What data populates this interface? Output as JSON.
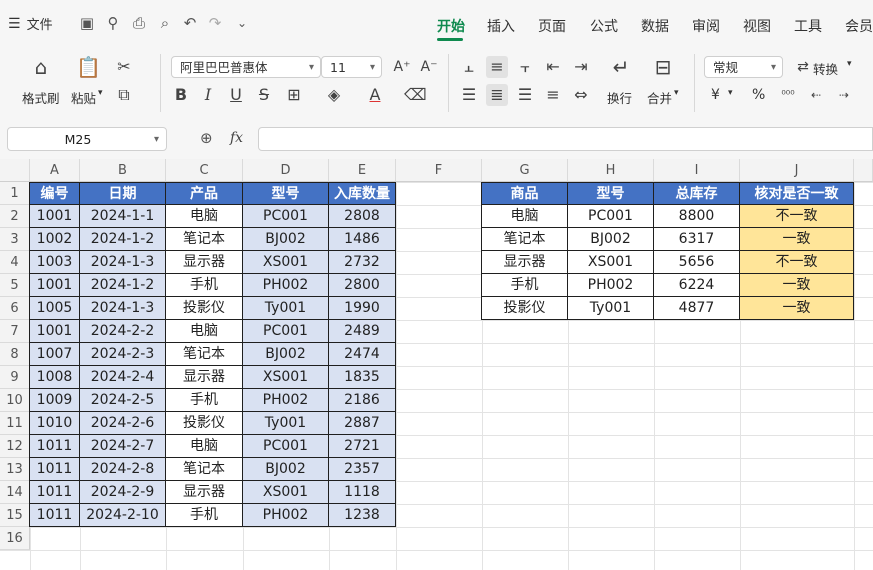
{
  "menubar": {
    "file_label": "文件",
    "tabs": [
      "开始",
      "插入",
      "页面",
      "公式",
      "数据",
      "审阅",
      "视图",
      "工具",
      "会员"
    ],
    "active_tab": "开始"
  },
  "ribbon": {
    "format_painter": "格式刷",
    "paste": "粘贴",
    "font_name": "阿里巴巴普惠体",
    "font_size": "11",
    "wrap": "换行",
    "merge": "合并",
    "number_format": "常规",
    "convert": "转换",
    "currency_symbol": "¥",
    "percent_symbol": "%"
  },
  "formula_bar": {
    "name_box": "M25",
    "fx": "fx",
    "content": ""
  },
  "columns": [
    "A",
    "B",
    "C",
    "D",
    "E",
    "F",
    "G",
    "H",
    "I",
    "J"
  ],
  "rows": [
    "1",
    "2",
    "3",
    "4",
    "5",
    "6",
    "7",
    "8",
    "9",
    "10",
    "11",
    "12",
    "13",
    "14",
    "15",
    "16"
  ],
  "table1": {
    "headers": [
      "编号",
      "日期",
      "产品",
      "型号",
      "入库数量"
    ],
    "rows": [
      [
        "1001",
        "2024-1-1",
        "电脑",
        "PC001",
        "2808"
      ],
      [
        "1002",
        "2024-1-2",
        "笔记本",
        "BJ002",
        "1486"
      ],
      [
        "1003",
        "2024-1-3",
        "显示器",
        "XS001",
        "2732"
      ],
      [
        "1001",
        "2024-1-2",
        "手机",
        "PH002",
        "2800"
      ],
      [
        "1005",
        "2024-1-3",
        "投影仪",
        "Ty001",
        "1990"
      ],
      [
        "1001",
        "2024-2-2",
        "电脑",
        "PC001",
        "2489"
      ],
      [
        "1007",
        "2024-2-3",
        "笔记本",
        "BJ002",
        "2474"
      ],
      [
        "1008",
        "2024-2-4",
        "显示器",
        "XS001",
        "1835"
      ],
      [
        "1009",
        "2024-2-5",
        "手机",
        "PH002",
        "2186"
      ],
      [
        "1010",
        "2024-2-6",
        "投影仪",
        "Ty001",
        "2887"
      ],
      [
        "1011",
        "2024-2-7",
        "电脑",
        "PC001",
        "2721"
      ],
      [
        "1011",
        "2024-2-8",
        "笔记本",
        "BJ002",
        "2357"
      ],
      [
        "1011",
        "2024-2-9",
        "显示器",
        "XS001",
        "1118"
      ],
      [
        "1011",
        "2024-2-10",
        "手机",
        "PH002",
        "1238"
      ]
    ]
  },
  "table2": {
    "headers": [
      "商品",
      "型号",
      "总库存",
      "核对是否一致"
    ],
    "rows": [
      [
        "电脑",
        "PC001",
        "8800",
        "不一致"
      ],
      [
        "笔记本",
        "BJ002",
        "6317",
        "一致"
      ],
      [
        "显示器",
        "XS001",
        "5656",
        "不一致"
      ],
      [
        "手机",
        "PH002",
        "6224",
        "一致"
      ],
      [
        "投影仪",
        "Ty001",
        "4877",
        "一致"
      ]
    ]
  },
  "colors": {
    "header_blue": "#4472c4",
    "row_blue": "#d9e1f2",
    "result_yellow": "#ffe599",
    "accent_green": "#0f8a4f"
  }
}
